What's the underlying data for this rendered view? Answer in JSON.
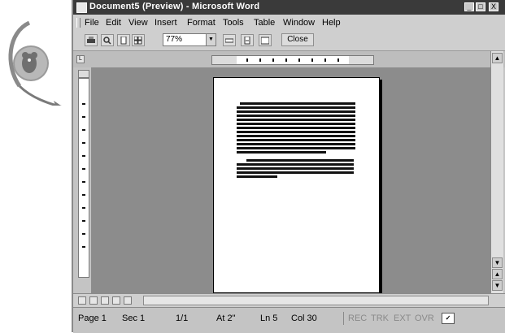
{
  "window": {
    "title": "Document5 (Preview) - Microsoft Word"
  },
  "title_controls": {
    "minimize": "_",
    "maximize": "□",
    "close": "X"
  },
  "menu": [
    "File",
    "Edit",
    "View",
    "Insert",
    "Format",
    "Tools",
    "Table",
    "Window",
    "Help"
  ],
  "toolbar": {
    "zoom_value": "77%",
    "close_label": "Close"
  },
  "statusbar": {
    "page": "Page 1",
    "sec": "Sec 1",
    "page_of": "1/1",
    "at": "At 2\"",
    "ln": "Ln 5",
    "col": "Col 30",
    "rec": "REC",
    "trk": "TRK",
    "ext": "EXT",
    "ovr": "OVR"
  },
  "icons": {
    "mascot": "paperclip-assistant-mascot",
    "app": "word-document-icon",
    "print": "print-icon",
    "magnifier": "magnifier-icon",
    "one_page": "one-page-icon",
    "multiple_pages": "multiple-pages-icon",
    "view_ruler": "view-ruler-icon",
    "shrink_to_fit": "shrink-to-fit-icon",
    "full_screen": "full-screen-icon",
    "status_book": "spelling-grammar-status-icon"
  },
  "colors": {
    "titlebar": "#3a3a3a",
    "workspace": "#8c8c8c",
    "chrome": "#cfcfcf"
  }
}
